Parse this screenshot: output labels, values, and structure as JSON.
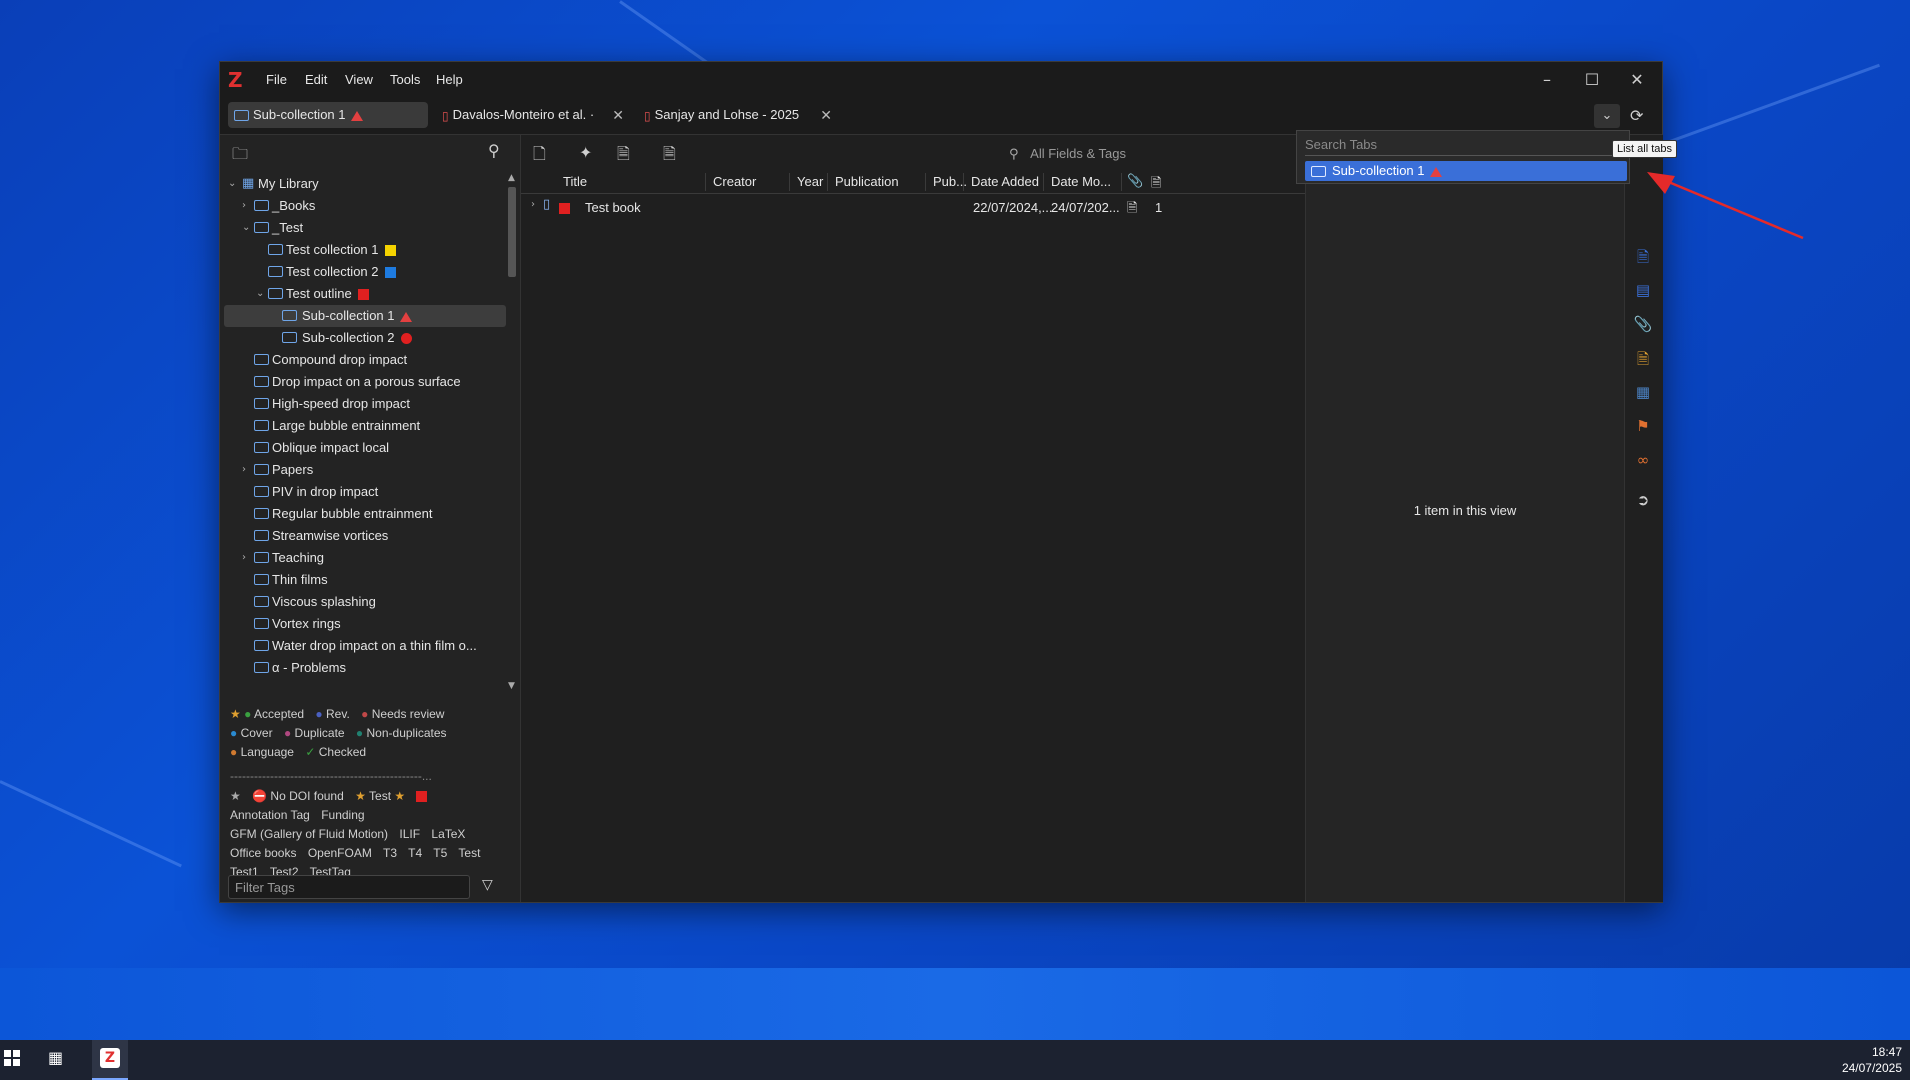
{
  "menus": [
    "File",
    "Edit",
    "View",
    "Tools",
    "Help"
  ],
  "tabs": [
    {
      "label": "Sub-collection 1"
    },
    {
      "label": "Davalos-Monteiro et al. ·"
    },
    {
      "label": "Sanjay and Lohse - 2025"
    }
  ],
  "tree": [
    {
      "label": "My Library"
    },
    {
      "label": "_Books"
    },
    {
      "label": "_Test"
    },
    {
      "label": "Test collection 1"
    },
    {
      "label": "Test collection 2"
    },
    {
      "label": "Test outline"
    },
    {
      "label": "Sub-collection 1"
    },
    {
      "label": "Sub-collection 2"
    },
    {
      "label": "Compound drop impact"
    },
    {
      "label": "Drop impact on a porous surface"
    },
    {
      "label": "High-speed drop impact"
    },
    {
      "label": "Large bubble entrainment"
    },
    {
      "label": "Oblique impact local"
    },
    {
      "label": "Papers"
    },
    {
      "label": "PIV in drop impact"
    },
    {
      "label": "Regular bubble entrainment"
    },
    {
      "label": "Streamwise vortices"
    },
    {
      "label": "Teaching"
    },
    {
      "label": "Thin films"
    },
    {
      "label": "Viscous splashing"
    },
    {
      "label": "Vortex rings"
    },
    {
      "label": "Water drop impact on a thin film o..."
    },
    {
      "label": "α - Problems"
    }
  ],
  "tags": {
    "line1": [
      "Accepted",
      "Rev.",
      "Needs review"
    ],
    "line2": [
      "Cover",
      "Duplicate",
      "Non-duplicates"
    ],
    "line3": [
      "Language",
      "Checked"
    ],
    "separator": "------------------------------------------------...",
    "line5": [
      "No DOI found",
      "Test"
    ],
    "line6": [
      "Annotation Tag",
      "Funding"
    ],
    "line7": [
      "GFM (Gallery of Fluid Motion)",
      "ILIF",
      "LaTeX"
    ],
    "line8": [
      "Office books",
      "OpenFOAM",
      "T3",
      "T4",
      "T5",
      "Test"
    ],
    "line9": [
      "Test1",
      "Test2",
      "TestTag"
    ],
    "filter_placeholder": "Filter Tags"
  },
  "search": {
    "placeholder": "All Fields & Tags"
  },
  "columns": [
    "Title",
    "Creator",
    "Year",
    "Publication",
    "Pub...",
    "Date Added",
    "Date Mo..."
  ],
  "item": {
    "title": "Test book",
    "date_added": "22/07/2024,...",
    "date_modified": "24/07/202...",
    "notes": "1"
  },
  "right_pane": {
    "status": "1 item in this view"
  },
  "popup": {
    "search_placeholder": "Search Tabs",
    "item": "Sub-collection 1"
  },
  "tooltip": "List all tabs",
  "clock": {
    "time": "18:47",
    "date": "24/07/2025"
  },
  "colors": {
    "accent": "#3a6fd8",
    "red": "#e03030",
    "yellow": "#f5d300",
    "blue": "#1e7be0"
  }
}
